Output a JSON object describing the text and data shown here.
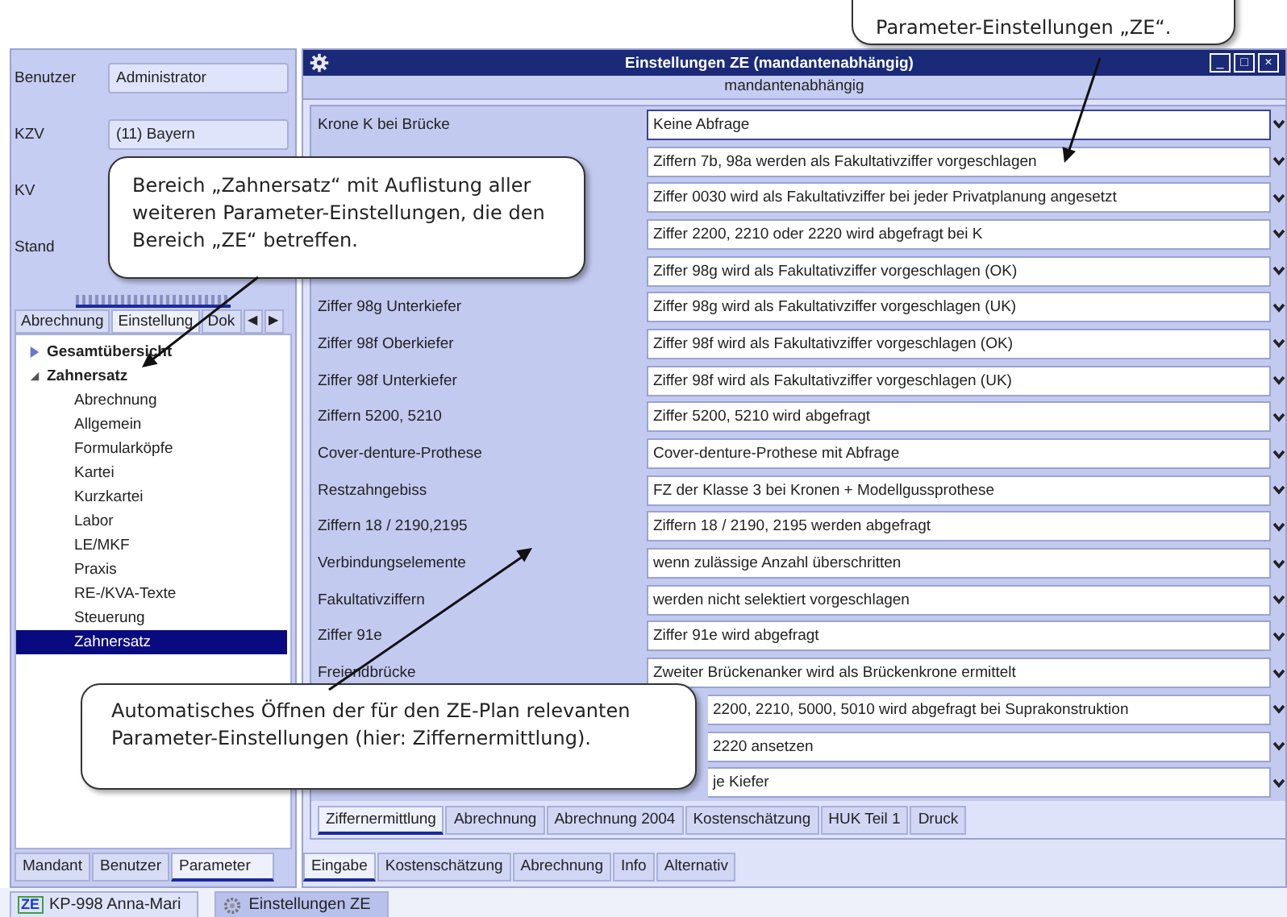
{
  "left_panel": {
    "fields": [
      {
        "label": "Benutzer",
        "value": "Administrator"
      },
      {
        "label": "KZV",
        "value": "(11) Bayern"
      },
      {
        "label": "KV"
      },
      {
        "label": "Stand"
      }
    ],
    "tabs": [
      {
        "label": "Abrechnung",
        "selected": false
      },
      {
        "label": "Einstellung",
        "selected": true
      },
      {
        "label": "Dok",
        "selected": false
      }
    ],
    "tab_scroll": [
      "◀",
      "▶"
    ],
    "tree": [
      {
        "label": "Gesamtübersicht",
        "expanded": false,
        "selected": false
      },
      {
        "label": "Zahnersatz",
        "expanded": true,
        "selected": false,
        "children": [
          {
            "label": "Abrechnung",
            "selected": false
          },
          {
            "label": "Allgemein",
            "selected": false
          },
          {
            "label": "Formularköpfe",
            "selected": false
          },
          {
            "label": "Kartei",
            "selected": false
          },
          {
            "label": "Kurzkartei",
            "selected": false
          },
          {
            "label": "Labor",
            "selected": false
          },
          {
            "label": "LE/MKF",
            "selected": false
          },
          {
            "label": "Praxis",
            "selected": false
          },
          {
            "label": "RE-/KVA-Texte",
            "selected": false
          },
          {
            "label": "Steuerung",
            "selected": false
          },
          {
            "label": "Zahnersatz",
            "selected": true
          }
        ]
      }
    ],
    "bottom_tabs": [
      {
        "label": "Mandant",
        "selected": false
      },
      {
        "label": "Benutzer",
        "selected": false
      },
      {
        "label": "Parameter",
        "selected": true
      }
    ]
  },
  "window": {
    "title": "Einstellungen ZE (mandantenabhängig)",
    "controls": [
      "_",
      "□",
      "×"
    ],
    "subtitle": "mandantenabhängig",
    "rows": [
      {
        "label": "Krone K bei Brücke",
        "value": "Keine Abfrage",
        "focused": true
      },
      {
        "value": "Ziffern 7b, 98a werden als Fakultativziffer vorgeschlagen",
        "focused": false
      },
      {
        "value": "Ziffer 0030 wird als Fakultativziffer bei jeder Privatplanung angesetzt",
        "focused": false
      },
      {
        "value": "Ziffer 2200, 2210 oder 2220 wird abgefragt bei K",
        "focused": false
      },
      {
        "value": "Ziffer 98g wird als Fakultativziffer vorgeschlagen (OK)",
        "focused": false
      },
      {
        "label": "Ziffer 98g Unterkiefer",
        "value": "Ziffer 98g wird als Fakultativziffer vorgeschlagen (UK)",
        "focused": false
      },
      {
        "label": "Ziffer 98f Oberkiefer",
        "value": "Ziffer 98f wird als Fakultativziffer vorgeschlagen (OK)",
        "focused": false
      },
      {
        "label": "Ziffer 98f Unterkiefer",
        "value": "Ziffer 98f wird als Fakultativziffer vorgeschlagen (UK)",
        "focused": false
      },
      {
        "label": "Ziffern 5200, 5210",
        "value": "Ziffer 5200, 5210 wird abgefragt",
        "focused": false
      },
      {
        "label": "Cover-denture-Prothese",
        "value": "Cover-denture-Prothese mit Abfrage",
        "focused": false
      },
      {
        "label": "Restzahngebiss",
        "value": "FZ der Klasse 3 bei Kronen + Modellgussprothese",
        "focused": false
      },
      {
        "label": "Ziffern 18 / 2190,2195",
        "value": "Ziffern 18 / 2190, 2195 werden abgefragt",
        "focused": false
      },
      {
        "label": "Verbindungselemente",
        "value": "wenn zulässige Anzahl überschritten",
        "focused": false
      },
      {
        "label": "Fakultativziffern",
        "value": "werden nicht selektiert vorgeschlagen",
        "focused": false
      },
      {
        "label": "Ziffer 91e",
        "value": "Ziffer 91e wird abgefragt",
        "focused": false
      },
      {
        "label": "Freiendbrücke",
        "value": "Zweiter Brückenanker wird als Brückenkrone ermittelt",
        "focused": false
      },
      {
        "value": "2200, 2210, 5000, 5010 wird abgefragt bei Suprakonstruktion",
        "focused": false,
        "covered": true
      },
      {
        "value": "2220 ansetzen",
        "focused": false,
        "covered": true
      },
      {
        "value": "je Kiefer",
        "focused": false,
        "covered": true
      }
    ],
    "tabs": [
      {
        "label": "Ziffernermittlung",
        "selected": true
      },
      {
        "label": "Abrechnung",
        "selected": false
      },
      {
        "label": "Abrechnung 2004",
        "selected": false
      },
      {
        "label": "Kostenschätzung",
        "selected": false
      },
      {
        "label": "HUK Teil 1",
        "selected": false
      },
      {
        "label": "Druck",
        "selected": false
      }
    ],
    "bottom_tabs": [
      {
        "label": "Eingabe",
        "selected": true
      },
      {
        "label": "Kostenschätzung",
        "selected": false
      },
      {
        "label": "Abrechnung",
        "selected": false
      },
      {
        "label": "Info",
        "selected": false
      },
      {
        "label": "Alternativ",
        "selected": false
      }
    ]
  },
  "taskbar": [
    {
      "label": "KP-998 Anna-Mari",
      "icon": "ZE",
      "kind": "patient",
      "selected": false
    },
    {
      "label": "Einstellungen ZE",
      "kind": "settings",
      "selected": true
    }
  ],
  "callouts": [
    {
      "kind": "zahnersatz",
      "text": "Bereich „Zahnersatz“ mit Auflistung aller weiteren Parameter-Einstellungen, die den Bereich „ZE“ betreffen."
    },
    {
      "kind": "auto",
      "text": "Automatisches Öffnen der für den ZE-Plan relevanten Parameter-Einstellungen (hier: Ziffernermittlung)."
    },
    {
      "kind": "top",
      "text": "Parameter-Einstellungen „ZE“."
    }
  ]
}
